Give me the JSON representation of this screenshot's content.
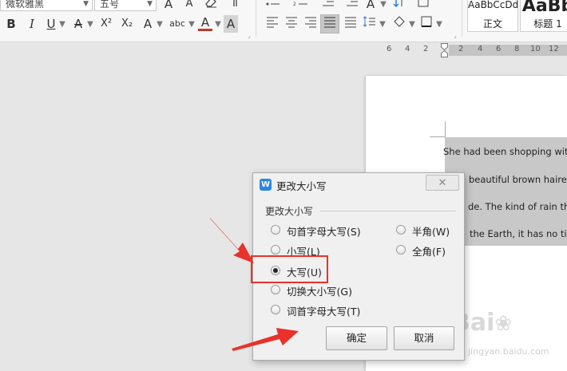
{
  "ribbon": {
    "font_name": "微软雅黑",
    "font_size": "五号",
    "grow_font_icon": "A",
    "shrink_font_icon": "A",
    "bold": "B",
    "italic": "I",
    "underline": "U",
    "strike": "A",
    "superscript": "X²",
    "subscript": "X₂",
    "text_effect": "A",
    "phonetic": "abc",
    "font_color": "A",
    "char_shading": "A",
    "styles": [
      {
        "sample": "AaBbCcDd",
        "label": "正文"
      },
      {
        "sample": "AaBb",
        "label": "标题 1"
      }
    ]
  },
  "ruler": {
    "numbers": [
      "6",
      "4",
      "2",
      "2",
      "4",
      "6",
      "8",
      "10",
      "12"
    ]
  },
  "document": {
    "lines": [
      "She had been shopping with",
      "beautiful  brown  haired",
      "de. The kind of rain that",
      "the Earth, it has no tim"
    ]
  },
  "dialog": {
    "title": "更改大小写",
    "close": "✕",
    "group_label": "更改大小写",
    "options": [
      {
        "label": "句首字母大写(S)",
        "checked": false
      },
      {
        "label": "小写(L)",
        "checked": false
      },
      {
        "label": "大写(U)",
        "checked": true
      },
      {
        "label": "切换大小写(G)",
        "checked": false
      },
      {
        "label": "词首字母大写(T)",
        "checked": false
      },
      {
        "label": "半角(W)",
        "checked": false
      },
      {
        "label": "全角(F)",
        "checked": false
      }
    ],
    "ok": "确定",
    "cancel": "取消"
  },
  "watermark": {
    "text": "Bai",
    "sub": "jingyan.baidu.com"
  },
  "colors": {
    "accent": "#2b86e0",
    "annotation": "#e8322b",
    "selection": "#c8c8c8"
  }
}
